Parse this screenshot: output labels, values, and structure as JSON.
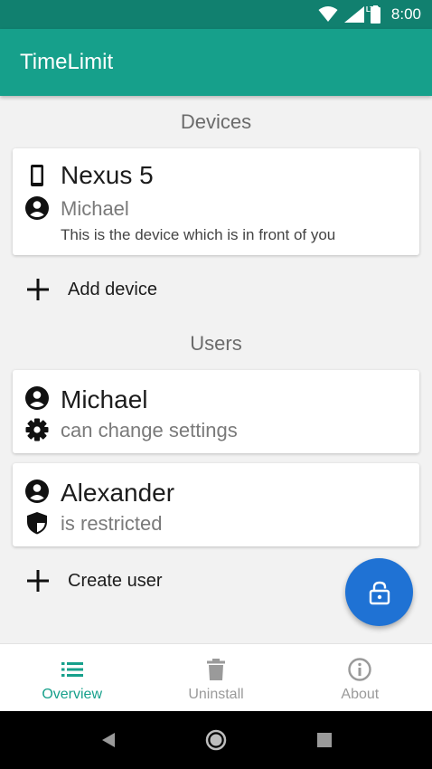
{
  "status_bar": {
    "time": "8:00",
    "network_label": "LTE"
  },
  "app_bar": {
    "title": "TimeLimit"
  },
  "devices_section": {
    "title": "Devices",
    "cards": [
      {
        "device_name": "Nexus 5",
        "user_name": "Michael",
        "note": "This is the device which is in front of you",
        "device_icon": "smartphone-icon",
        "user_icon": "account-circle-icon"
      }
    ],
    "add_label": "Add device"
  },
  "users_section": {
    "title": "Users",
    "cards": [
      {
        "name": "Michael",
        "status": "can change settings",
        "user_icon": "account-circle-icon",
        "status_icon": "settings-gear-icon"
      },
      {
        "name": "Alexander",
        "status": "is restricted",
        "user_icon": "account-circle-icon",
        "status_icon": "shield-icon"
      }
    ],
    "create_label": "Create user"
  },
  "fab": {
    "icon": "lock-open-icon",
    "color": "#1f72d4"
  },
  "bottom_nav": {
    "items": [
      {
        "label": "Overview",
        "icon": "list-icon",
        "active": true
      },
      {
        "label": "Uninstall",
        "icon": "trash-icon",
        "active": false
      },
      {
        "label": "About",
        "icon": "info-icon",
        "active": false
      }
    ]
  },
  "colors": {
    "primary": "#16a08b",
    "primary_dark": "#11806f",
    "accent": "#1f72d4"
  }
}
